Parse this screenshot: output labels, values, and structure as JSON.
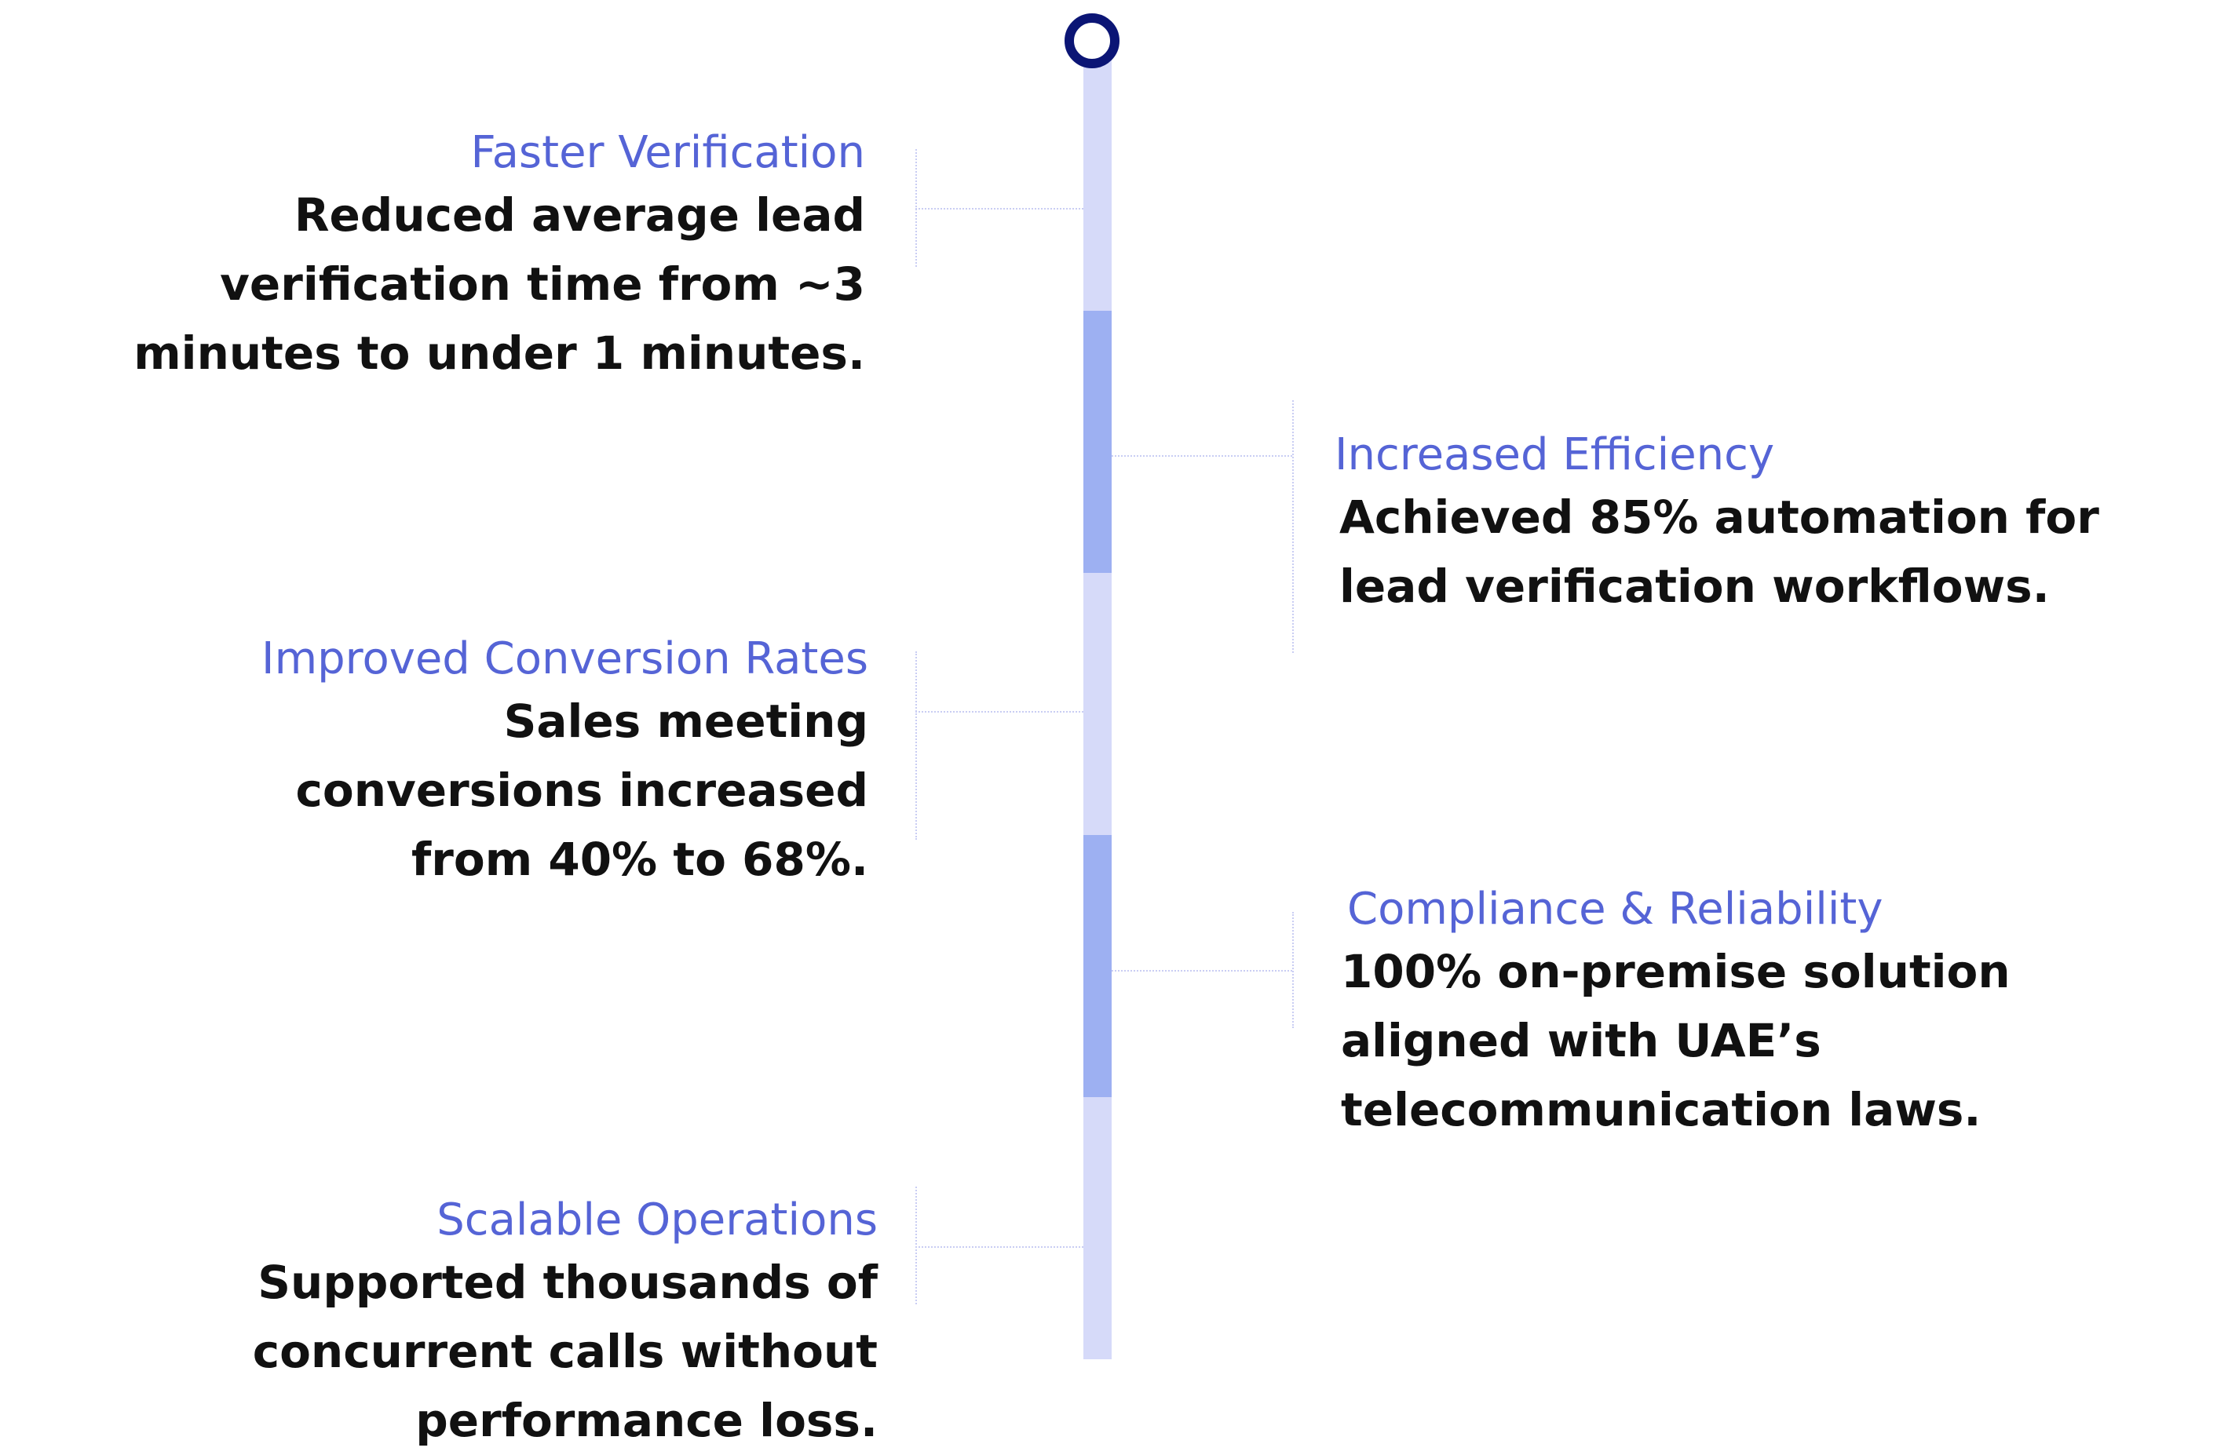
{
  "timeline": {
    "items": [
      {
        "title": "Faster Verification",
        "description": "Reduced average lead verification time from ~3 minutes to under 1 minutes."
      },
      {
        "title": "Increased Efficiency",
        "description": "Achieved 85% automation for lead verification workflows."
      },
      {
        "title": "Improved Conversion Rates",
        "description": "Sales meeting conversions increased from 40% to 68%."
      },
      {
        "title": "Compliance & Reliability",
        "description": "100% on-premise solution aligned with UAE’s telecommunication laws."
      },
      {
        "title": "Scalable Operations",
        "description": "Supported thousands of concurrent calls without performance loss."
      }
    ]
  },
  "colors": {
    "title_text": "#5564d6",
    "body_text": "#111111",
    "spine_light": "#d6daf9",
    "spine_dark": "#9db0f2",
    "start_marker": "#0b1575"
  }
}
